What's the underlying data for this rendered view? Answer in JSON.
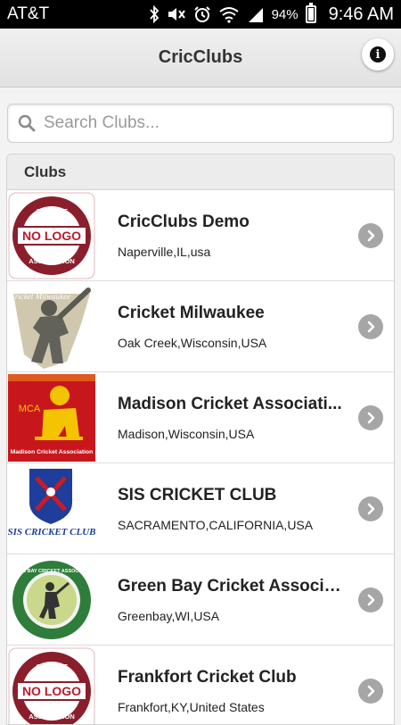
{
  "status_bar": {
    "carrier": "AT&T",
    "battery_pct": "94%",
    "time": "9:46 AM",
    "icons": [
      "bluetooth-icon",
      "mute-icon",
      "alarm-icon",
      "wifi-icon",
      "signal-icon",
      "battery-icon"
    ]
  },
  "header": {
    "title": "CricClubs",
    "info_icon": "info-icon"
  },
  "search": {
    "placeholder": "Search Clubs...",
    "value": ""
  },
  "list": {
    "header": "Clubs",
    "clubs": [
      {
        "name": "CricClubs Demo",
        "location": "Naperville,IL,usa",
        "logo": "no-logo-badge"
      },
      {
        "name": "Cricket Milwaukee",
        "location": "Oak Creek,Wisconsin,USA",
        "logo": "cricket-milwaukee-logo",
        "logo_text": "Cricket Milwaukee"
      },
      {
        "name": "Madison Cricket Associati...",
        "location": "Madison,Wisconsin,USA",
        "logo": "mca-logo",
        "logo_text": "MCA",
        "logo_subtext": "Madison Cricket Association"
      },
      {
        "name": "SIS CRICKET CLUB",
        "location": "SACRAMENTO,CALIFORNIA,USA",
        "logo": "sis-logo",
        "logo_text": "SIS CRICKET CLUB"
      },
      {
        "name": "Green Bay Cricket Associat...",
        "location": "Greenbay,WI,USA",
        "logo": "green-bay-logo",
        "logo_text": "GREEN BAY CRICKET ASSOCIATION"
      },
      {
        "name": "Frankfort Cricket Club",
        "location": "Frankfort,KY,United States",
        "logo": "no-logo-badge"
      }
    ],
    "no_logo": {
      "top": "CRICKET",
      "middle": "NO LOGO",
      "bottom": "ASSOCIATION"
    }
  },
  "colors": {
    "status_bar": "#000000",
    "header_bg": "#e8e8e8",
    "chevron": "#a6a6a6",
    "no_logo_red": "#8b1e2b",
    "mca_bg": "#c8171c",
    "mca_yellow": "#f5c400",
    "green_bay": "#2e7d3a"
  }
}
